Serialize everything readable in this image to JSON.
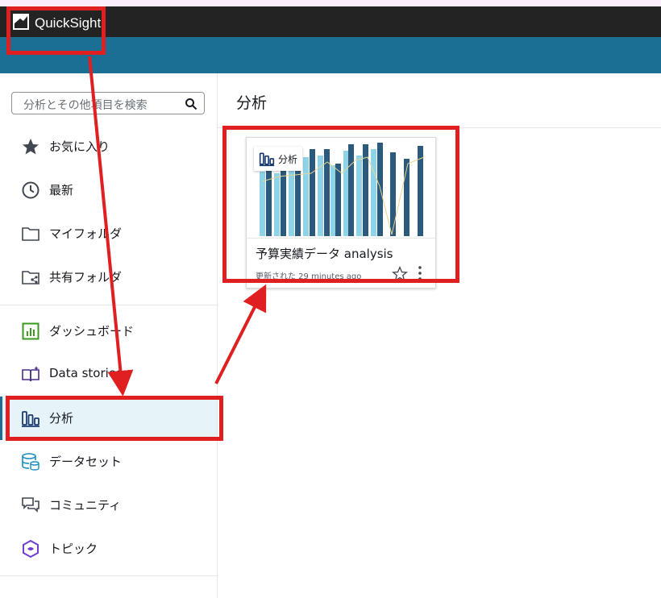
{
  "app": {
    "name": "QuickSight"
  },
  "search": {
    "placeholder": "分析とその他項目を検索"
  },
  "sidebar": {
    "items": [
      {
        "label": "お気に入り",
        "icon": "star-icon"
      },
      {
        "label": "最新",
        "icon": "clock-icon"
      },
      {
        "label": "マイフォルダ",
        "icon": "folder-icon"
      },
      {
        "label": "共有フォルダ",
        "icon": "shared-folder-icon"
      },
      {
        "label": "ダッシュボード",
        "icon": "dashboard-icon"
      },
      {
        "label": "Data stories",
        "icon": "data-stories-icon"
      },
      {
        "label": "分析",
        "icon": "analysis-icon",
        "active": true
      },
      {
        "label": "データセット",
        "icon": "dataset-icon"
      },
      {
        "label": "コミュニティ",
        "icon": "community-icon"
      },
      {
        "label": "トピック",
        "icon": "topic-icon"
      }
    ]
  },
  "main": {
    "title": "分析",
    "cards": [
      {
        "badge": "分析",
        "title": "予算実績データ analysis",
        "updated": "更新された 29 minutes ago"
      }
    ]
  },
  "colors": {
    "brand_bar": "#1b6e94",
    "top_bar": "#232323",
    "annotation": "#e02020",
    "active_bg": "#e6f3f9"
  }
}
